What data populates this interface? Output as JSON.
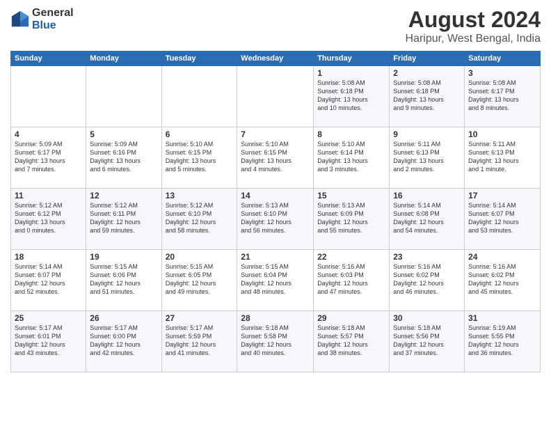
{
  "logo": {
    "general": "General",
    "blue": "Blue"
  },
  "title": {
    "month_year": "August 2024",
    "location": "Haripur, West Bengal, India"
  },
  "weekdays": [
    "Sunday",
    "Monday",
    "Tuesday",
    "Wednesday",
    "Thursday",
    "Friday",
    "Saturday"
  ],
  "weeks": [
    [
      {
        "day": "",
        "info": ""
      },
      {
        "day": "",
        "info": ""
      },
      {
        "day": "",
        "info": ""
      },
      {
        "day": "",
        "info": ""
      },
      {
        "day": "1",
        "info": "Sunrise: 5:08 AM\nSunset: 6:18 PM\nDaylight: 13 hours\nand 10 minutes."
      },
      {
        "day": "2",
        "info": "Sunrise: 5:08 AM\nSunset: 6:18 PM\nDaylight: 13 hours\nand 9 minutes."
      },
      {
        "day": "3",
        "info": "Sunrise: 5:08 AM\nSunset: 6:17 PM\nDaylight: 13 hours\nand 8 minutes."
      }
    ],
    [
      {
        "day": "4",
        "info": "Sunrise: 5:09 AM\nSunset: 6:17 PM\nDaylight: 13 hours\nand 7 minutes."
      },
      {
        "day": "5",
        "info": "Sunrise: 5:09 AM\nSunset: 6:16 PM\nDaylight: 13 hours\nand 6 minutes."
      },
      {
        "day": "6",
        "info": "Sunrise: 5:10 AM\nSunset: 6:15 PM\nDaylight: 13 hours\nand 5 minutes."
      },
      {
        "day": "7",
        "info": "Sunrise: 5:10 AM\nSunset: 6:15 PM\nDaylight: 13 hours\nand 4 minutes."
      },
      {
        "day": "8",
        "info": "Sunrise: 5:10 AM\nSunset: 6:14 PM\nDaylight: 13 hours\nand 3 minutes."
      },
      {
        "day": "9",
        "info": "Sunrise: 5:11 AM\nSunset: 6:13 PM\nDaylight: 13 hours\nand 2 minutes."
      },
      {
        "day": "10",
        "info": "Sunrise: 5:11 AM\nSunset: 6:13 PM\nDaylight: 13 hours\nand 1 minute."
      }
    ],
    [
      {
        "day": "11",
        "info": "Sunrise: 5:12 AM\nSunset: 6:12 PM\nDaylight: 13 hours\nand 0 minutes."
      },
      {
        "day": "12",
        "info": "Sunrise: 5:12 AM\nSunset: 6:11 PM\nDaylight: 12 hours\nand 59 minutes."
      },
      {
        "day": "13",
        "info": "Sunrise: 5:12 AM\nSunset: 6:10 PM\nDaylight: 12 hours\nand 58 minutes."
      },
      {
        "day": "14",
        "info": "Sunrise: 5:13 AM\nSunset: 6:10 PM\nDaylight: 12 hours\nand 56 minutes."
      },
      {
        "day": "15",
        "info": "Sunrise: 5:13 AM\nSunset: 6:09 PM\nDaylight: 12 hours\nand 55 minutes."
      },
      {
        "day": "16",
        "info": "Sunrise: 5:14 AM\nSunset: 6:08 PM\nDaylight: 12 hours\nand 54 minutes."
      },
      {
        "day": "17",
        "info": "Sunrise: 5:14 AM\nSunset: 6:07 PM\nDaylight: 12 hours\nand 53 minutes."
      }
    ],
    [
      {
        "day": "18",
        "info": "Sunrise: 5:14 AM\nSunset: 6:07 PM\nDaylight: 12 hours\nand 52 minutes."
      },
      {
        "day": "19",
        "info": "Sunrise: 5:15 AM\nSunset: 6:06 PM\nDaylight: 12 hours\nand 51 minutes."
      },
      {
        "day": "20",
        "info": "Sunrise: 5:15 AM\nSunset: 6:05 PM\nDaylight: 12 hours\nand 49 minutes."
      },
      {
        "day": "21",
        "info": "Sunrise: 5:15 AM\nSunset: 6:04 PM\nDaylight: 12 hours\nand 48 minutes."
      },
      {
        "day": "22",
        "info": "Sunrise: 5:16 AM\nSunset: 6:03 PM\nDaylight: 12 hours\nand 47 minutes."
      },
      {
        "day": "23",
        "info": "Sunrise: 5:16 AM\nSunset: 6:02 PM\nDaylight: 12 hours\nand 46 minutes."
      },
      {
        "day": "24",
        "info": "Sunrise: 5:16 AM\nSunset: 6:02 PM\nDaylight: 12 hours\nand 45 minutes."
      }
    ],
    [
      {
        "day": "25",
        "info": "Sunrise: 5:17 AM\nSunset: 6:01 PM\nDaylight: 12 hours\nand 43 minutes."
      },
      {
        "day": "26",
        "info": "Sunrise: 5:17 AM\nSunset: 6:00 PM\nDaylight: 12 hours\nand 42 minutes."
      },
      {
        "day": "27",
        "info": "Sunrise: 5:17 AM\nSunset: 5:59 PM\nDaylight: 12 hours\nand 41 minutes."
      },
      {
        "day": "28",
        "info": "Sunrise: 5:18 AM\nSunset: 5:58 PM\nDaylight: 12 hours\nand 40 minutes."
      },
      {
        "day": "29",
        "info": "Sunrise: 5:18 AM\nSunset: 5:57 PM\nDaylight: 12 hours\nand 38 minutes."
      },
      {
        "day": "30",
        "info": "Sunrise: 5:18 AM\nSunset: 5:56 PM\nDaylight: 12 hours\nand 37 minutes."
      },
      {
        "day": "31",
        "info": "Sunrise: 5:19 AM\nSunset: 5:55 PM\nDaylight: 12 hours\nand 36 minutes."
      }
    ]
  ]
}
